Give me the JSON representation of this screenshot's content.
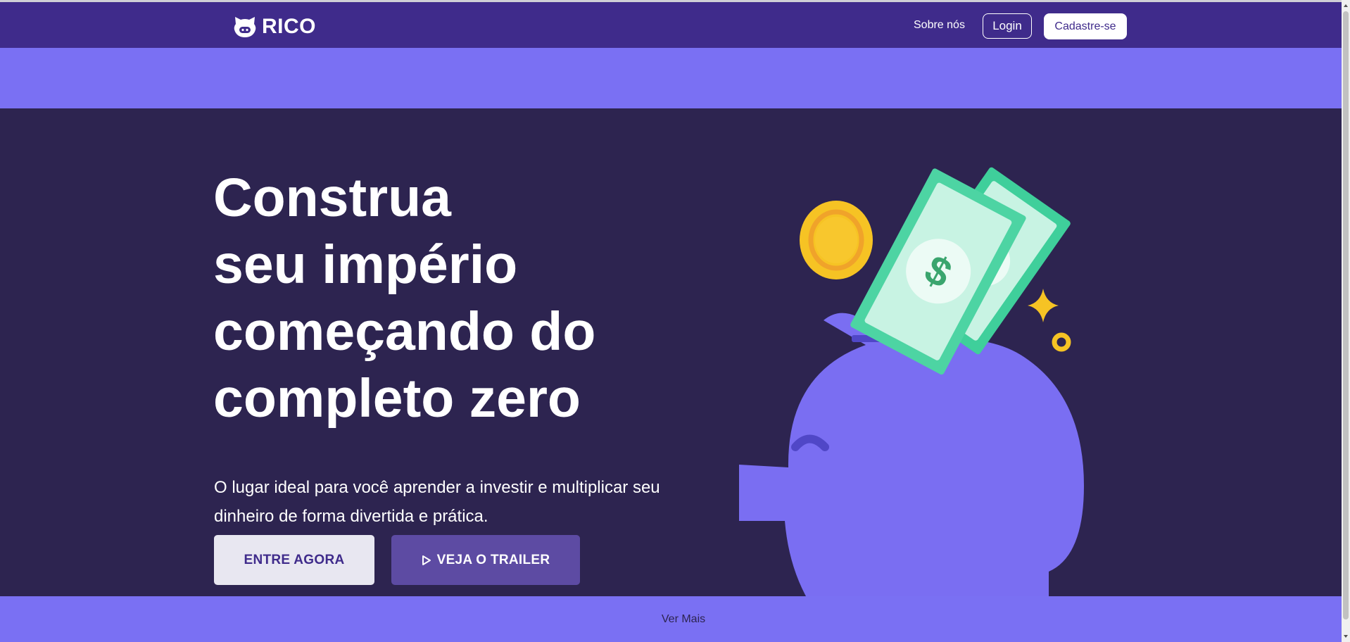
{
  "nav": {
    "brand": "RICO",
    "about_label": "Sobre nós",
    "login_label": "Login",
    "signup_label": "Cadastre-se"
  },
  "hero": {
    "headline_lines": [
      "Construa",
      "seu império",
      "começando do",
      "completo zero"
    ],
    "subtitle": "O lugar ideal para você aprender a investir e multiplicar seu dinheiro de forma divertida e prática.",
    "primary_cta": "ENTRE AGORA",
    "secondary_cta": "VEJA O TRAILER"
  },
  "footer": {
    "more_label": "Ver Mais"
  },
  "icons": {
    "logo": "pig-logo-icon",
    "play": "play-icon",
    "illustration": "piggy-bank-illustration"
  },
  "colors": {
    "navbar": "#3f2b8b",
    "accent": "#7a70f3",
    "hero_bg": "#2d2450",
    "primary_button": "#e8e7f1",
    "secondary_button": "#5d4ba3",
    "coin": "#f6c324",
    "banknote": "#4dd4a3"
  }
}
